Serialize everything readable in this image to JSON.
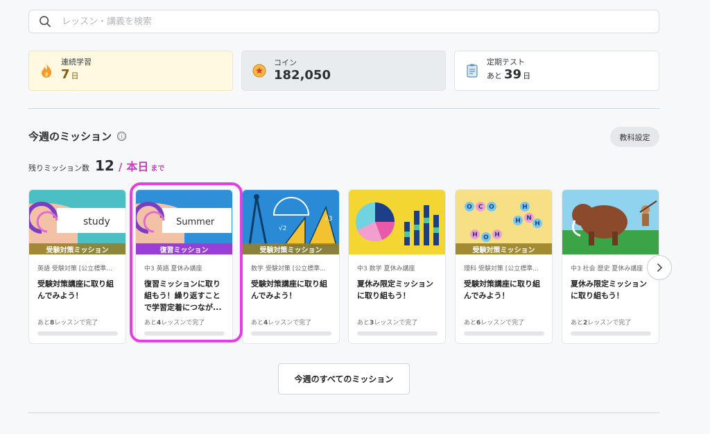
{
  "search": {
    "placeholder": "レッスン・講義を検索",
    "value": ""
  },
  "stats": {
    "streak": {
      "label": "連続学習",
      "value": "7",
      "unit": "日"
    },
    "coins": {
      "label": "コイン",
      "value": "182,050"
    },
    "exam": {
      "label": "定期テスト",
      "prefix": "あと",
      "value": "39",
      "unit": "日"
    }
  },
  "missions": {
    "title": "今週のミッション",
    "info_icon": "ⓘ",
    "subject_settings": "教科設定",
    "remaining_label": "残りミッション数",
    "remaining_count": "12",
    "separator": "/",
    "deadline": "本日",
    "deadline_suffix": "まで",
    "view_all": "今週のすべてのミッション",
    "cards": [
      {
        "band": "受験対策ミッション",
        "meta": "英語 受験対策 [公立標準...",
        "title": "受験対策講座に取り組んでみよう！",
        "progress_pre": "あと",
        "progress_num": "8",
        "progress_post": "レッスンで完了",
        "progress": 0
      },
      {
        "band": "復習ミッション",
        "meta": "中3 英語 夏休み講座",
        "title": "復習ミッションに取り組もう！繰り返すことで学習定着につなが...",
        "progress_pre": "あと",
        "progress_num": "4",
        "progress_post": "レッスンで完了",
        "progress": 0
      },
      {
        "band": "受験対策ミッション",
        "meta": "数学 受験対策 [公立標準...",
        "title": "受験対策講座に取り組んでみよう！",
        "progress_pre": "あと",
        "progress_num": "4",
        "progress_post": "レッスンで完了",
        "progress": 0
      },
      {
        "band": "",
        "meta": "中3 数学 夏休み講座",
        "title": "夏休み限定ミッションに取り組もう！",
        "progress_pre": "あと",
        "progress_num": "3",
        "progress_post": "レッスンで完了",
        "progress": 0
      },
      {
        "band": "受験対策ミッション",
        "meta": "理科 受験対策 [公立標準...",
        "title": "受験対策講座に取り組んでみよう！",
        "progress_pre": "あと",
        "progress_num": "6",
        "progress_post": "レッスンで完了",
        "progress": 0
      },
      {
        "band": "",
        "meta": "中3 社会 歴史 夏休み講座",
        "title": "夏休み限定ミッションに取り組もう！",
        "progress_pre": "あと",
        "progress_num": "2",
        "progress_post": "レッスンで完了",
        "progress": 0
      }
    ],
    "thumb_words": {
      "study": "study",
      "summer": "Summer"
    }
  },
  "icons": {
    "search": "search-icon",
    "flame": "flame-icon",
    "coin": "coin-icon",
    "clipboard": "clipboard-icon",
    "next": "chevron-right-icon"
  },
  "colors": {
    "accent": "#c83bc2",
    "highlight": "#e53fe3",
    "streak_bg": "#fef9e0",
    "band_purple": "#9a3ed8"
  }
}
